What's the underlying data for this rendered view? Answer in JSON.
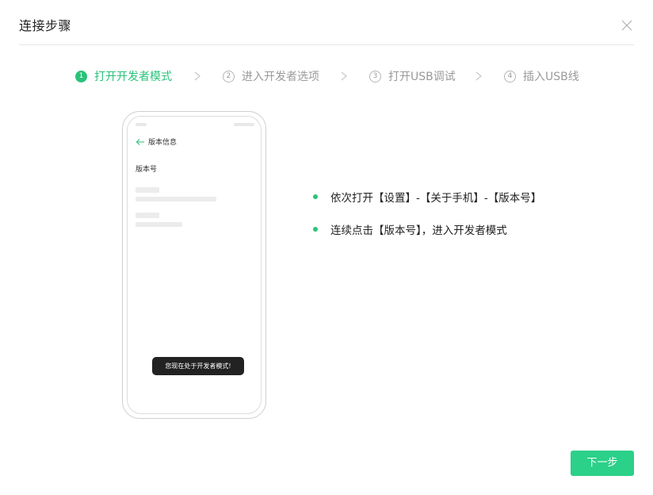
{
  "dialog": {
    "title": "连接步骤",
    "close_icon": "close-icon"
  },
  "steps": [
    {
      "number": "1",
      "label": "打开开发者模式",
      "active": true
    },
    {
      "number": "2",
      "label": "进入开发者选项",
      "active": false
    },
    {
      "number": "3",
      "label": "打开USB调试",
      "active": false
    },
    {
      "number": "4",
      "label": "插入USB线",
      "active": false
    }
  ],
  "phone": {
    "header_title": "版本信息",
    "item_label": "版本号",
    "toast": "您现在处于开发者模式!"
  },
  "instructions": [
    "依次打开【设置】-【关于手机】-【版本号】",
    "连续点击【版本号】，进入开发者模式"
  ],
  "footer": {
    "next_label": "下一步"
  },
  "colors": {
    "accent": "#2ac27a",
    "button": "#2bd089"
  }
}
